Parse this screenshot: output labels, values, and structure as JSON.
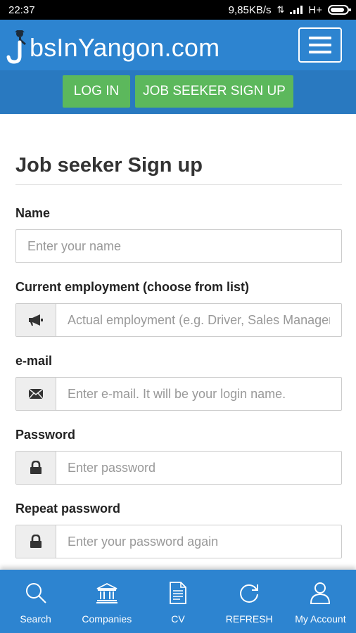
{
  "status_bar": {
    "time": "22:37",
    "network_speed": "9,85KB/s",
    "network_type": "H+",
    "battery_level": 0.85
  },
  "header": {
    "logo_text": "bsInYangon.com",
    "logo_initial": "J",
    "menu_icon": "hamburger-icon"
  },
  "auth_bar": {
    "login_label": "LOG IN",
    "signup_label": "JOB SEEKER SIGN UP",
    "button_color": "#5cb85c"
  },
  "form": {
    "title": "Job seeker Sign up",
    "fields": {
      "name": {
        "label": "Name",
        "placeholder": "Enter your name"
      },
      "employment": {
        "label": "Current employment (choose from list)",
        "placeholder": "Actual employment (e.g. Driver, Sales Manager)",
        "icon": "megaphone-icon"
      },
      "email": {
        "label": "e-mail",
        "placeholder": "Enter e-mail. It will be your login name.",
        "icon": "envelope-icon"
      },
      "password": {
        "label": "Password",
        "placeholder": "Enter password",
        "icon": "lock-icon"
      },
      "repeat_password": {
        "label": "Repeat password",
        "placeholder": "Enter your password again",
        "icon": "lock-icon"
      }
    }
  },
  "bottom_nav": {
    "items": [
      {
        "label": "Search",
        "icon": "search-icon"
      },
      {
        "label": "Companies",
        "icon": "bank-icon"
      },
      {
        "label": "CV",
        "icon": "document-icon"
      },
      {
        "label": "REFRESH",
        "icon": "refresh-icon"
      },
      {
        "label": "My Account",
        "icon": "user-icon"
      }
    ]
  },
  "colors": {
    "header_blue": "#2d84d0",
    "subbar_blue": "#2979c0",
    "green": "#5cb85c"
  }
}
